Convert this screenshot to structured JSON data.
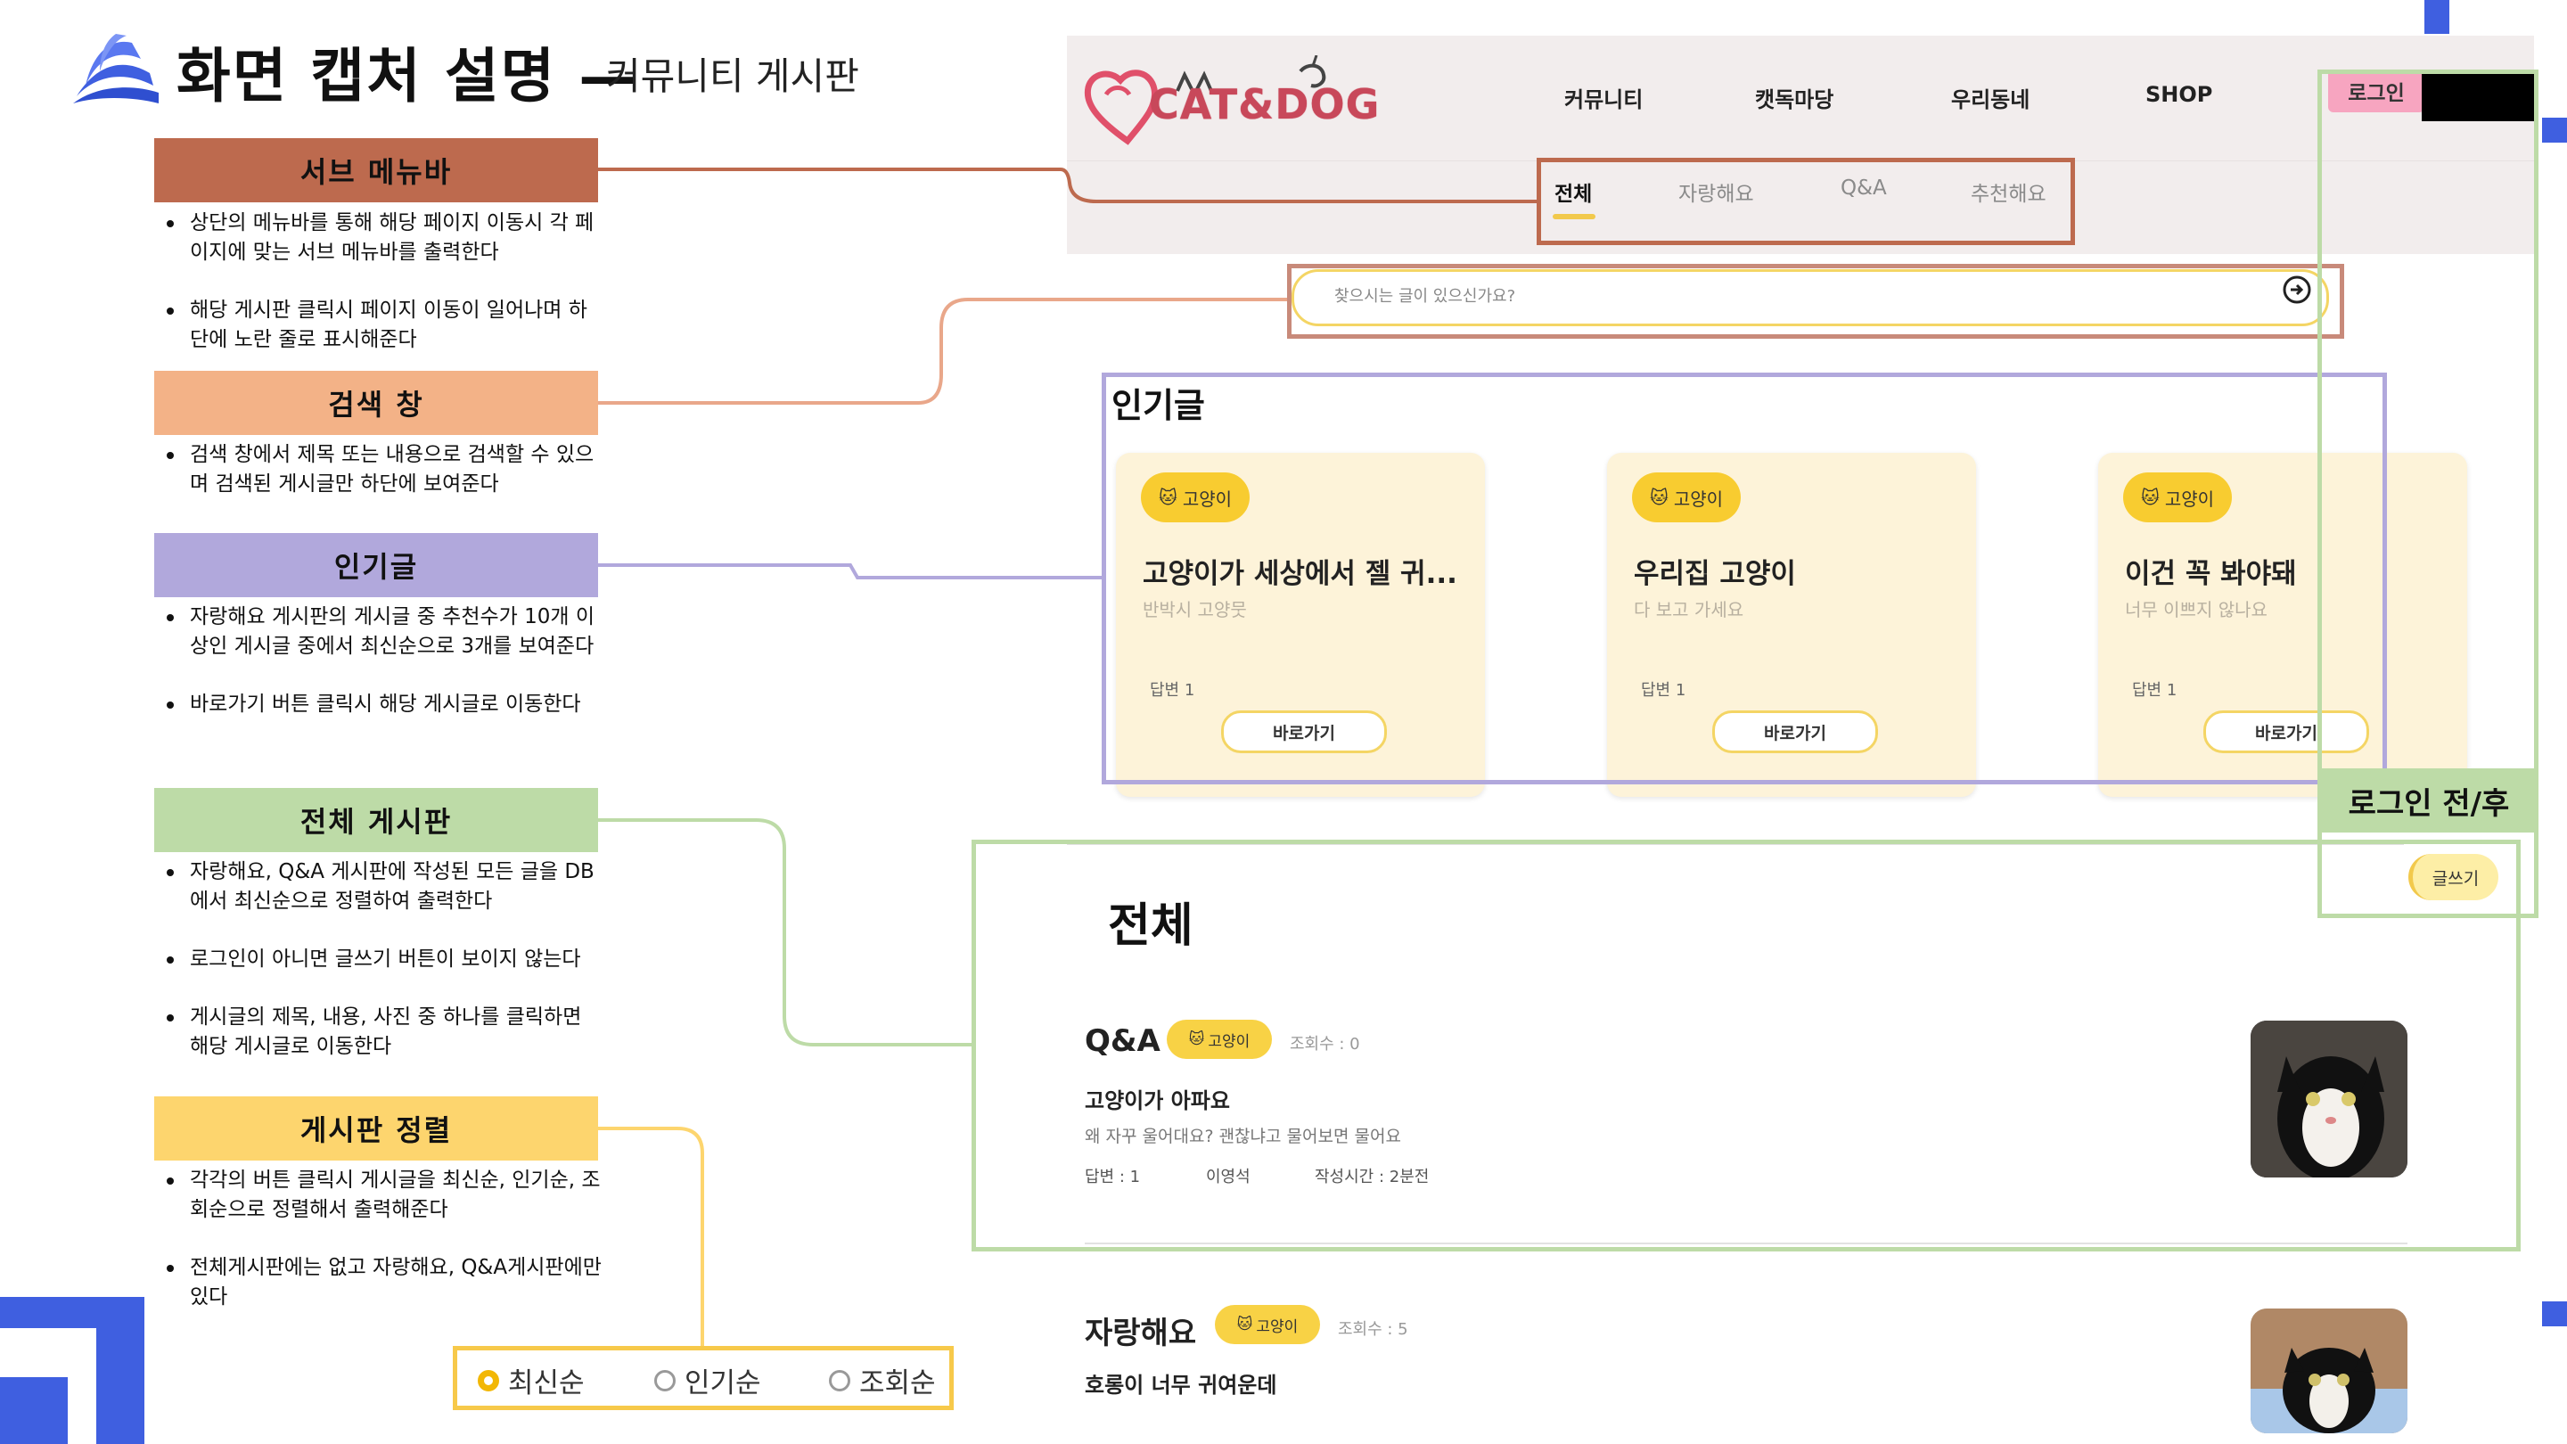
{
  "header": {
    "title": "화면 캡처 설명",
    "dash": "—",
    "subtitle": "커뮤니티 게시판"
  },
  "sections": [
    {
      "key": "submenu",
      "label": "서브 메뉴바",
      "color": "#bd6a4e",
      "bullets": [
        "상단의 메뉴바를 통해 해당 페이지 이동시 각 페이지에 맞는 서브 메뉴바를 출력한다",
        "해당 게시판 클릭시 페이지 이동이 일어나며 하단에 노란 줄로 표시해준다"
      ]
    },
    {
      "key": "search",
      "label": "검색 창",
      "color": "#f3b287",
      "bullets": [
        "검색 창에서 제목 또는 내용으로 검색할 수 있으며 검색된 게시글만 하단에 보여준다"
      ]
    },
    {
      "key": "popular",
      "label": "인기글",
      "color": "#b1a8dc",
      "bullets": [
        "자랑해요 게시판의 게시글 중 추천수가 10개 이상인 게시글 중에서 최신순으로 3개를 보여준다",
        "바로가기 버튼 클릭시 해당 게시글로 이동한다"
      ]
    },
    {
      "key": "board",
      "label": "전체 게시판",
      "color": "#bddba7",
      "bullets": [
        "자랑해요, Q&A 게시판에 작성된 모든 글을 DB에서 최신순으로 정렬하여 출력한다",
        "로그인이 아니면 글쓰기 버튼이 보이지 않는다",
        "게시글의 제목, 내용, 사진 중 하나를 클릭하면 해당 게시글로 이동한다"
      ]
    },
    {
      "key": "sort",
      "label": "게시판 정렬",
      "color": "#fdd56e",
      "bullets": [
        "각각의 버튼 클릭시 게시글을 최신순, 인기순, 조회순으로 정렬해서 출력해준다",
        "전체게시판에는 없고 자랑해요, Q&A게시판에만 있다"
      ]
    }
  ],
  "site": {
    "brand": "CAT&DOG",
    "nav": [
      "커뮤니티",
      "캣독마당",
      "우리동네",
      "SHOP"
    ],
    "login": "로그인",
    "subtabs": [
      "전체",
      "자랑해요",
      "Q&A",
      "추천해요"
    ],
    "active_subtab": "전체",
    "search_placeholder": "찾으시는 글이 있으신가요?",
    "popular_title": "인기글",
    "popular_cards": [
      {
        "badge": "고양이",
        "title": "고양이가 세상에서 젤 귀...",
        "sub": "반박시 고양뭇",
        "answers": "답변 1",
        "go": "바로가기"
      },
      {
        "badge": "고양이",
        "title": "우리집 고양이",
        "sub": "다 보고 가세요",
        "answers": "답변 1",
        "go": "바로가기"
      },
      {
        "badge": "고양이",
        "title": "이건 꼭 봐야돼",
        "sub": "너무 이쁘지 않나요",
        "answers": "답변 1",
        "go": "바로가기"
      }
    ],
    "board_title": "전체",
    "write_label": "글쓰기",
    "posts": [
      {
        "category": "Q&A",
        "badge": "고양이",
        "views": "조회수 : 0",
        "title": "고양이가 아파요",
        "body": "왜 자꾸 울어대요? 괜찮냐고 물어보면 물어요",
        "answers": "답변 : 1",
        "author": "이영석",
        "time": "작성시간 : 2분전"
      },
      {
        "category": "자랑해요",
        "badge": "고양이",
        "views": "조회수 : 5",
        "title": "호롱이 너무 귀여운데",
        "body": "",
        "answers": "",
        "author": "",
        "time": ""
      }
    ]
  },
  "login_tag": "로그인 전/후",
  "sort_options": [
    {
      "label": "최신순",
      "selected": true
    },
    {
      "label": "인기순",
      "selected": false
    },
    {
      "label": "조회순",
      "selected": false
    }
  ],
  "colors": {
    "accent_yellow": "#f8cc30",
    "login_pink": "#f7a5c0",
    "brand_red": "#c8485a",
    "deco_blue": "#3f5fe0"
  }
}
